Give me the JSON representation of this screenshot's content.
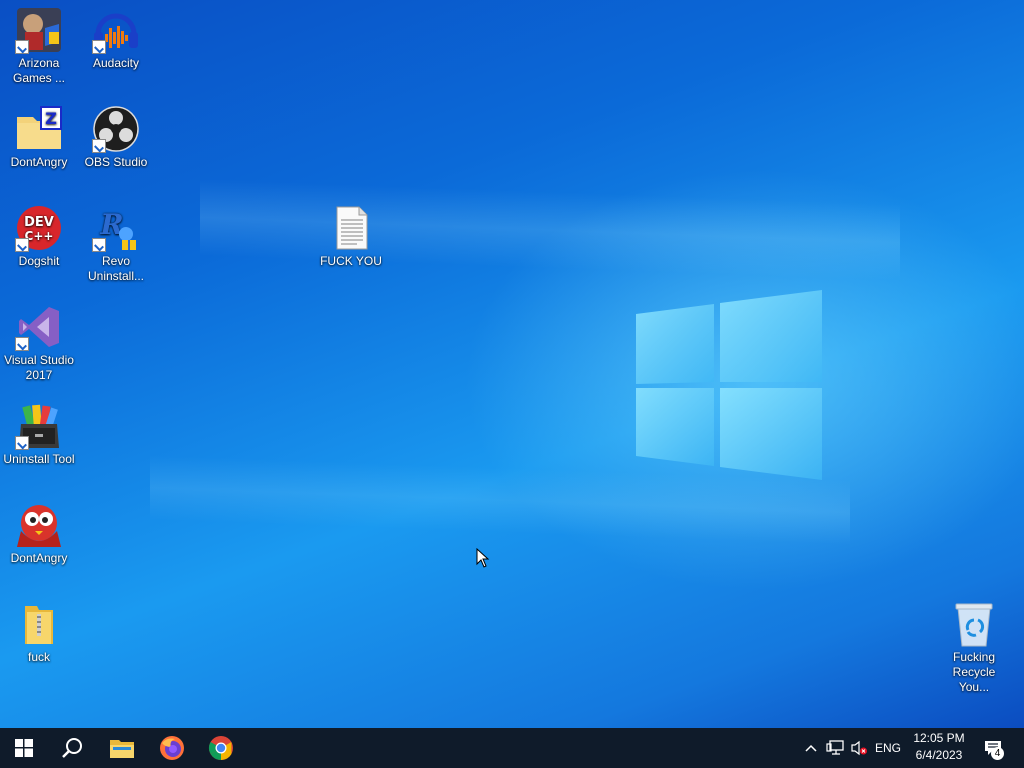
{
  "desktop": {
    "icons": [
      {
        "label": "Arizona Games ...",
        "icon": "game-launcher-icon",
        "shortcut": true
      },
      {
        "label": "Audacity",
        "icon": "audacity-icon",
        "shortcut": true
      },
      {
        "label": "DontAngry",
        "icon": "zip-archive-icon",
        "shortcut": false
      },
      {
        "label": "OBS Studio",
        "icon": "obs-icon",
        "shortcut": true
      },
      {
        "label": "Dogshit",
        "icon": "dev-cpp-icon",
        "shortcut": true
      },
      {
        "label": "Revo Uninstall...",
        "icon": "revo-uninstaller-icon",
        "shortcut": true
      },
      {
        "label": "FUCK YOU",
        "icon": "text-document-icon",
        "shortcut": false
      },
      {
        "label": "Visual Studio 2017",
        "icon": "visual-studio-icon",
        "shortcut": true
      },
      {
        "label": "Uninstall Tool",
        "icon": "uninstall-tool-icon",
        "shortcut": true
      },
      {
        "label": "DontAngry",
        "icon": "red-character-icon",
        "shortcut": false
      },
      {
        "label": "fuck",
        "icon": "folder-icon",
        "shortcut": false
      },
      {
        "label": "Fucking Recycle You...",
        "icon": "recycle-bin-icon",
        "shortcut": false
      }
    ]
  },
  "taskbar": {
    "start": "windows-start-icon",
    "search": "search-icon",
    "pinned": [
      "file-explorer-icon",
      "firefox-icon",
      "chrome-icon"
    ],
    "tray": {
      "chevron": "chevron-up-icon",
      "network": "network-icon",
      "volume": "volume-muted-icon",
      "language": "ENG"
    },
    "clock": {
      "time": "12:05 PM",
      "date": "6/4/2023"
    },
    "notifications": {
      "icon": "action-center-icon",
      "count": "4"
    }
  },
  "colors": {
    "taskbar": "#0f1b2a",
    "desktop_dark": "#0a4fc4",
    "desktop_light": "#1a9af0"
  }
}
